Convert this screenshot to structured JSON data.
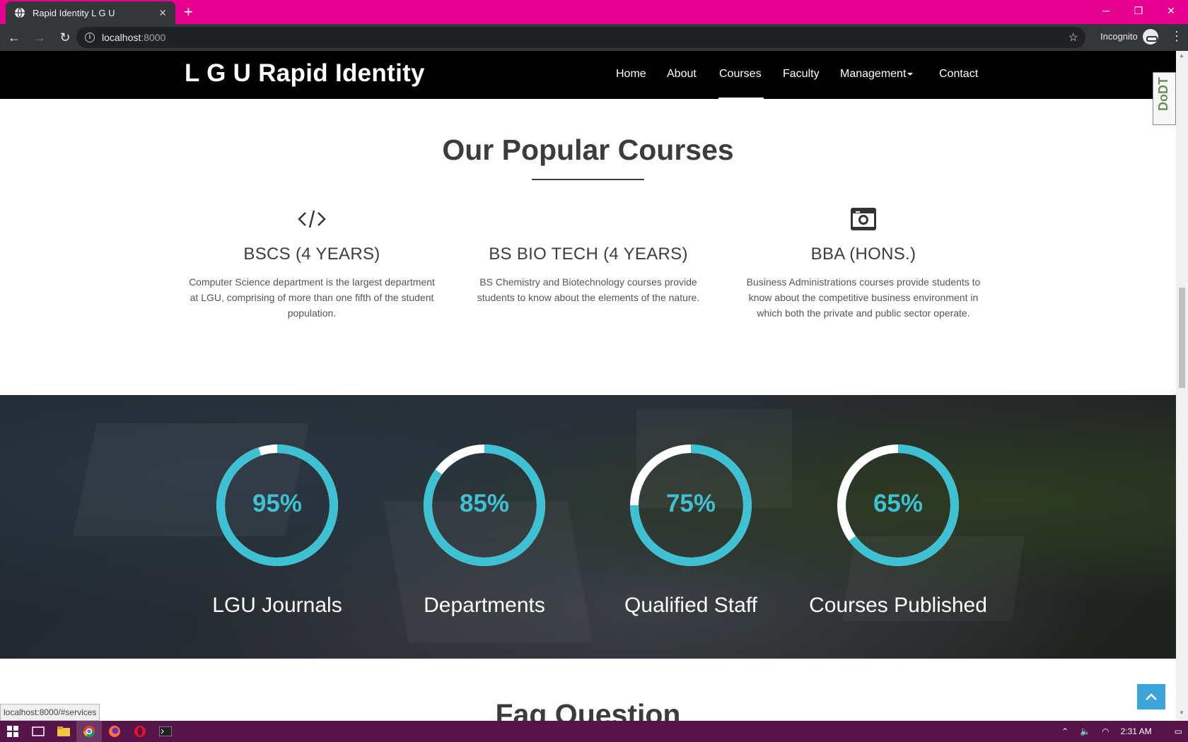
{
  "browser": {
    "tab_title": "Rapid Identity L G U",
    "url_host": "localhost",
    "url_port": ":8000",
    "incognito_label": "Incognito",
    "status_url": "localhost:8000/#services"
  },
  "site": {
    "brand": "L G U Rapid Identity",
    "nav": [
      "Home",
      "About",
      "Courses",
      "Faculty",
      "Management",
      "Contact"
    ],
    "active_nav": "Courses",
    "devtool_tab": "DoDT"
  },
  "courses": {
    "title": "Our Popular Courses",
    "items": [
      {
        "icon": "code-icon",
        "name": "BSCS (4 YEARS)",
        "desc": "Computer Science department is the largest department at LGU, comprising of more than one fifth of the student population."
      },
      {
        "icon": "none",
        "name": "BS BIO TECH (4 YEARS)",
        "desc": "BS Chemistry and Biotechnology courses provide students to know about the elements of the nature."
      },
      {
        "icon": "camera-icon",
        "name": "BBA (HONS.)",
        "desc": "Business Administrations courses provide students to know about the competitive business environment in which both the private and public sector operate."
      }
    ]
  },
  "stats": {
    "accent": "#3ec1d3",
    "items": [
      {
        "percent": "95%",
        "value": 0.95,
        "label": "LGU Journals"
      },
      {
        "percent": "85%",
        "value": 0.85,
        "label": "Departments"
      },
      {
        "percent": "75%",
        "value": 0.75,
        "label": "Qualified Staff"
      },
      {
        "percent": "65%",
        "value": 0.65,
        "label": "Courses Published"
      }
    ]
  },
  "faq": {
    "title": "Faq Question"
  },
  "taskbar": {
    "time": "2:31 AM"
  }
}
